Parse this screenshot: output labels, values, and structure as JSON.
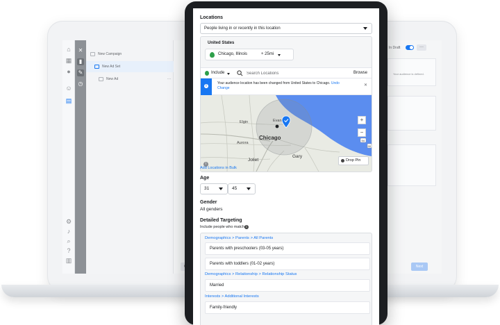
{
  "laptop": {
    "tree": {
      "campaign": "New Campaign",
      "adset": "New Ad Set",
      "ad": "New Ad"
    },
    "draft_label": "In Draft",
    "more_label": "···",
    "next_label": "Next",
    "close_label": "Clos",
    "side_text": "Your audience is defined."
  },
  "locations": {
    "label": "Locations",
    "mode_value": "People living in or recently in this location",
    "country": "United States",
    "city": "Chicago, Illinois",
    "radius": "+ 25mi",
    "include_label": "Include",
    "search_placeholder": "Search Locations",
    "browse_label": "Browse",
    "notice_text": "Your audience location has been changed from United States to Chicago.",
    "notice_undo": "Undo Change",
    "map_labels": {
      "evanston": "Evanston",
      "elgin": "Elgin",
      "chicago": "Chicago",
      "aurora": "Aurora",
      "joliet": "Joliet",
      "gary": "Gary",
      "shield_94": "94",
      "shield_90": "90"
    },
    "drop_pin_label": "Drop Pin",
    "add_bulk_link": "Add Locations in Bulk"
  },
  "age": {
    "label": "Age",
    "min": "31",
    "max": "45"
  },
  "gender": {
    "label": "Gender",
    "value": "All genders"
  },
  "detailed_targeting": {
    "label": "Detailed Targeting",
    "sub_label": "Include people who match",
    "groups": [
      {
        "path": "Demographics > Parents > All Parents",
        "items": [
          "Parents with preschoolers (03-05 years)",
          "Parents with toddlers (01-02 years)"
        ]
      },
      {
        "path": "Demographics > Relationship > Relationship Status",
        "items": [
          "Married"
        ]
      },
      {
        "path": "Interests > Additional Interests",
        "items": [
          "Family-friendly"
        ]
      }
    ]
  },
  "colors": {
    "accent": "#1877f2",
    "include_green": "#2e9f4a",
    "lake": "#5b8def"
  }
}
